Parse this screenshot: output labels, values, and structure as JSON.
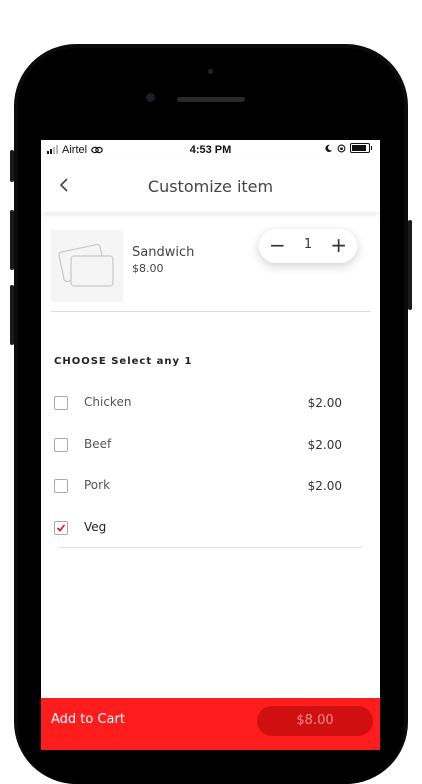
{
  "status_bar": {
    "carrier": "Airtel",
    "time": "4:53 PM"
  },
  "header": {
    "title": "Customize item",
    "back_icon": "chevron-left-icon"
  },
  "item": {
    "name": "Sandwich",
    "price": "$8.00",
    "quantity": "1"
  },
  "section": {
    "title": "CHOOSE Select any 1"
  },
  "options": [
    {
      "label": "Chicken",
      "price": "$2.00",
      "checked": false
    },
    {
      "label": "Beef",
      "price": "$2.00",
      "checked": false
    },
    {
      "label": "Pork",
      "price": "$2.00",
      "checked": false
    },
    {
      "label": "Veg",
      "price": "",
      "checked": true
    }
  ],
  "cart": {
    "label": "Add to Cart",
    "total": "$8.00"
  },
  "colors": {
    "accent": "#ff1c1c",
    "accent_dark": "#d01010"
  }
}
